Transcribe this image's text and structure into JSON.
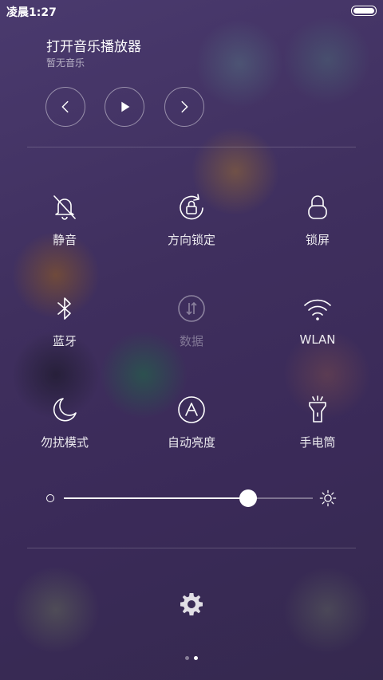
{
  "status_bar": {
    "time": "凌晨1:27"
  },
  "music": {
    "title": "打开音乐播放器",
    "subtitle": "暂无音乐",
    "controls": [
      "prev-icon",
      "play-icon",
      "next-icon"
    ]
  },
  "toggles": [
    {
      "label": "静音",
      "icon": "bell-off-icon",
      "enabled": true
    },
    {
      "label": "方向锁定",
      "icon": "rotation-lock-icon",
      "enabled": true
    },
    {
      "label": "锁屏",
      "icon": "lock-icon",
      "enabled": true
    },
    {
      "label": "蓝牙",
      "icon": "bluetooth-icon",
      "enabled": true
    },
    {
      "label": "数据",
      "icon": "data-icon",
      "enabled": false
    },
    {
      "label": "WLAN",
      "icon": "wifi-icon",
      "enabled": true
    },
    {
      "label": "勿扰模式",
      "icon": "moon-icon",
      "enabled": true
    },
    {
      "label": "自动亮度",
      "icon": "auto-brightness-icon",
      "enabled": true
    },
    {
      "label": "手电筒",
      "icon": "flashlight-icon",
      "enabled": true
    }
  ],
  "brightness": {
    "value": 0.74
  },
  "pager": {
    "count": 2,
    "active": 1
  },
  "colors": {
    "background": "#3f2f5e",
    "foreground": "#ffffff"
  }
}
